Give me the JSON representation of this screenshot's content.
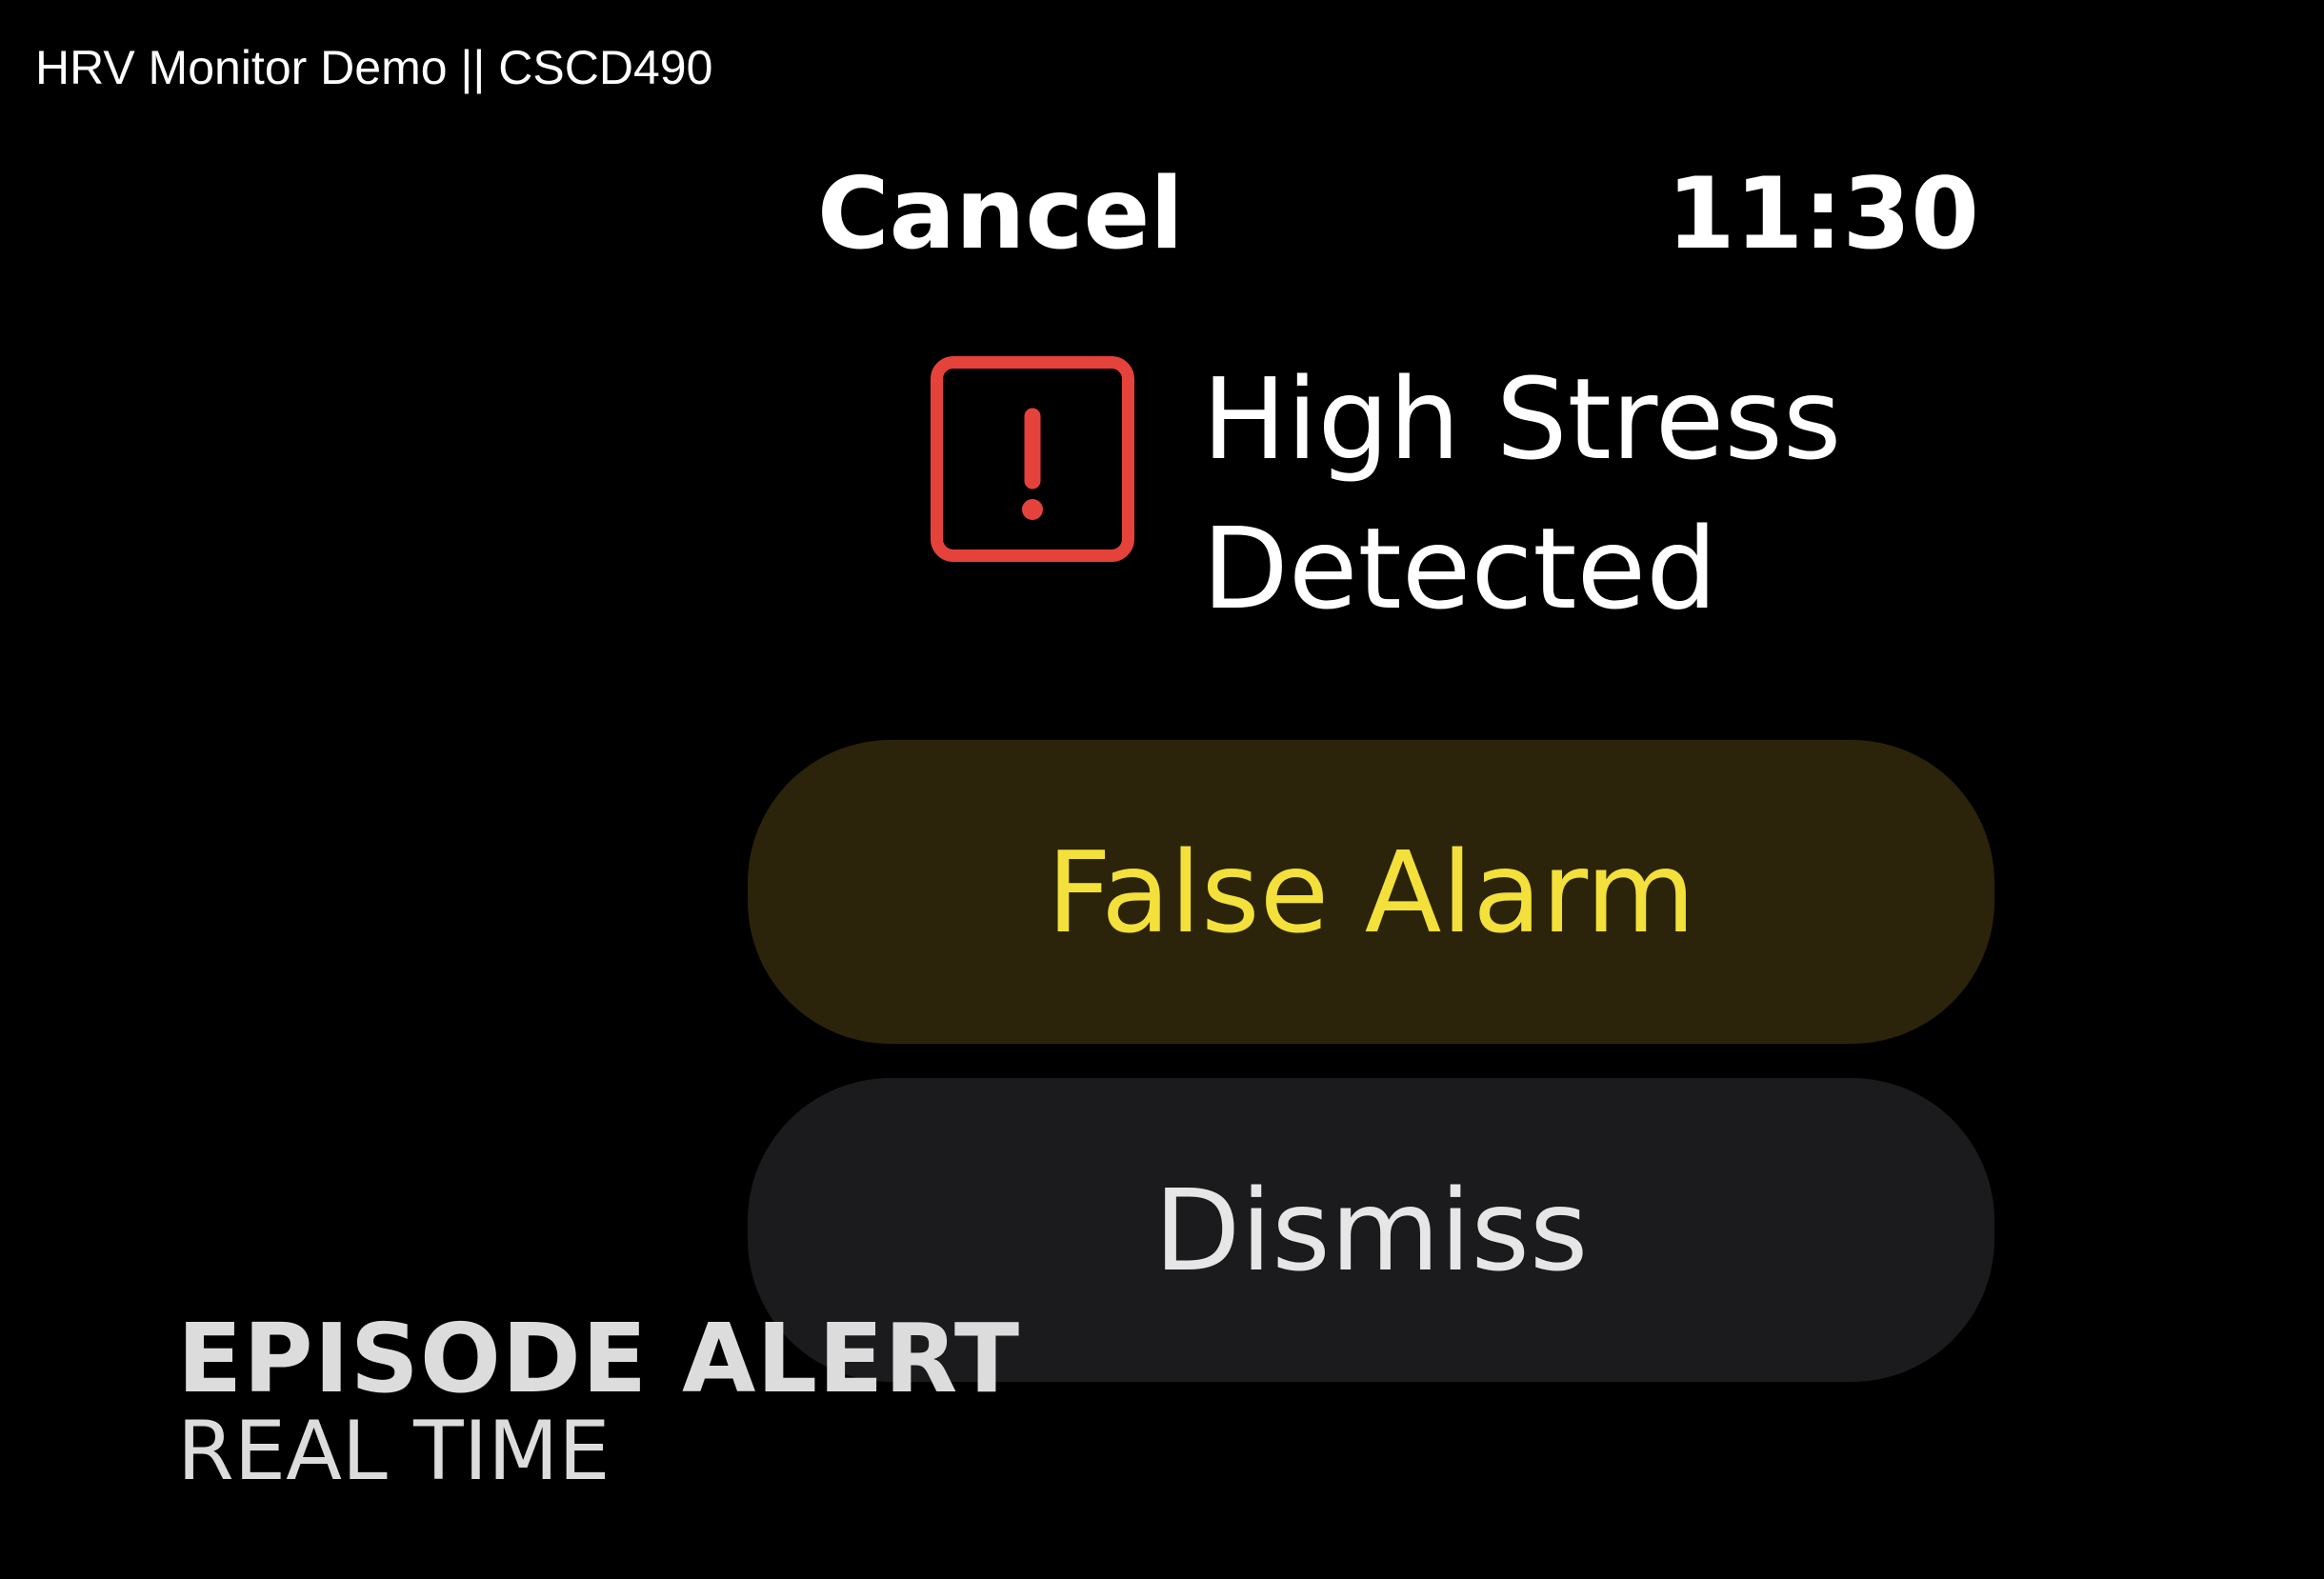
{
  "video": {
    "title": "HRV Monitor Demo || CSCD490"
  },
  "watch": {
    "cancel_label": "Cancel",
    "time": "11:30",
    "alert": {
      "icon": "exclamation-icon",
      "icon_color": "#e5423b",
      "title_line1": "High Stress",
      "title_line2": "Detected"
    },
    "buttons": {
      "false_alarm_label": "False Alarm",
      "false_alarm_color": "#f3e03a",
      "dismiss_label": "Dismiss"
    }
  },
  "caption": {
    "title": "EPISODE ALERT",
    "subtitle": "REAL TIME"
  }
}
